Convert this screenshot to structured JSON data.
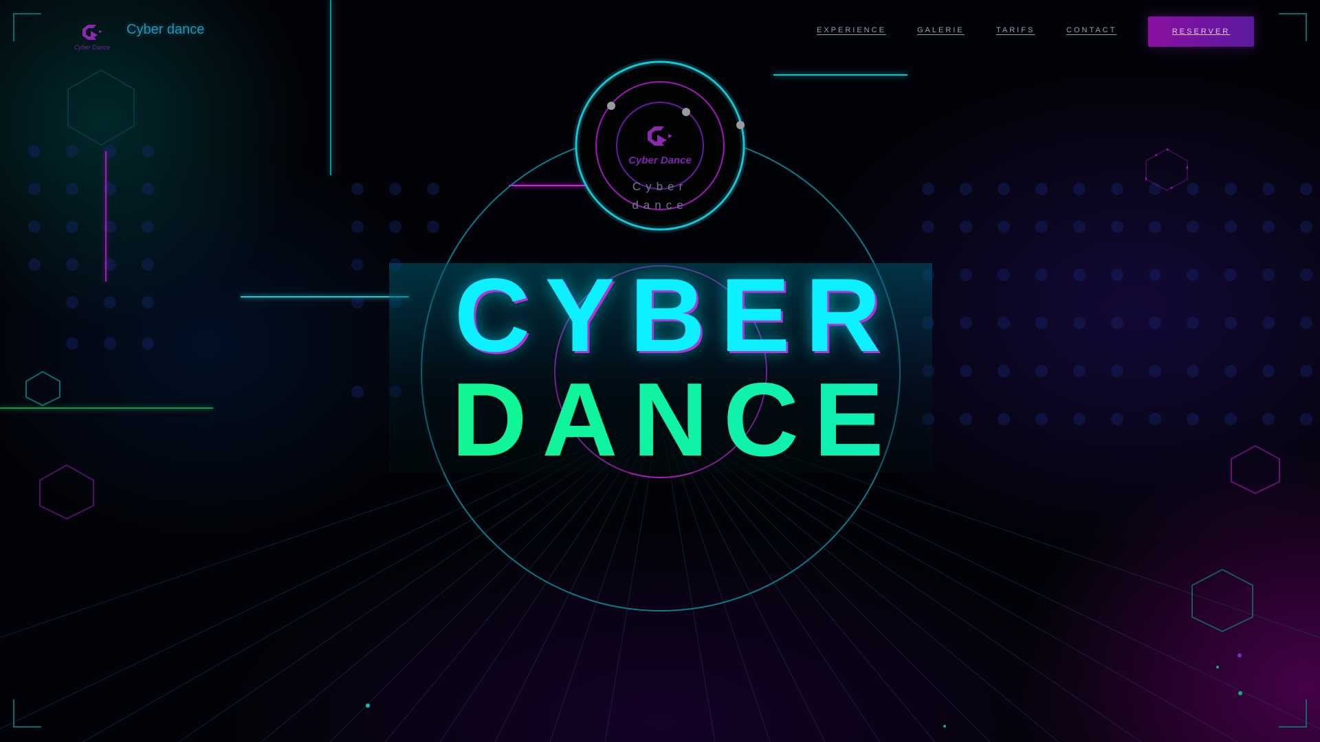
{
  "header": {
    "brand": "Cyber dance",
    "logo_text": "Cyber Dance",
    "nav": [
      "EXPERIENCE",
      "GALERIE",
      "TARIFS",
      "CONTACT"
    ],
    "cta_label": "RESERVER"
  },
  "hero": {
    "emblem_logo_text": "Cyber Dance",
    "emblem_line1": "Cyber",
    "emblem_line2": "dance",
    "title_line1": "CYBER",
    "title_line2": "DANCE"
  },
  "colors": {
    "cyan": "#0cf0ff",
    "green": "#12ff6a",
    "magenta": "#c020d0",
    "purple": "#7a1aa8",
    "cta": "#8a10a0"
  },
  "icons": [
    "cyber-dance-logo-icon"
  ]
}
